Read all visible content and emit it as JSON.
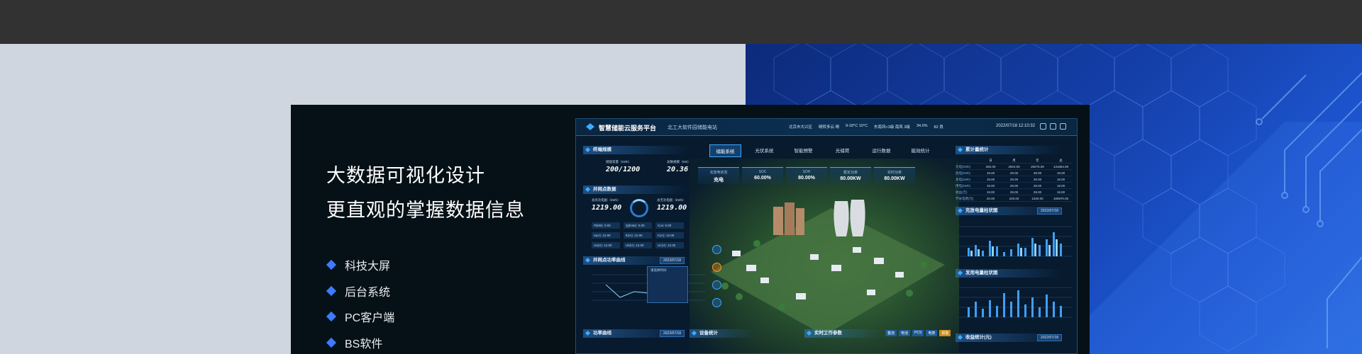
{
  "headline": {
    "line1": "大数据可视化设计",
    "line2": "更直观的掌握数据信息"
  },
  "features": [
    "科技大屏",
    "后台系统",
    "PC客户端",
    "BS软件"
  ],
  "colors": {
    "accent": "#3d7bff",
    "card_bg": "#061117",
    "blue_bg": "#143fa8"
  },
  "dashboard": {
    "title": "智慧储能云服务平台",
    "subtitle": "北工大软件园储能电站",
    "weather": [
      "北京市大兴区",
      "晴转多云 晴",
      "9-18°C 10°C",
      "东南风<3级 南风 3级",
      "34.0%",
      "82 良"
    ],
    "datetime": "2022/07/18  12:10:32",
    "nav_tabs": [
      "储能系统",
      "光伏系统",
      "智能预警",
      "光储荷",
      "运行数据",
      "能效统计"
    ],
    "active_tab": "储能系统",
    "kpis": [
      {
        "label": "充放电状态",
        "value": "充电"
      },
      {
        "label": "SOC",
        "value": "60.00%"
      },
      {
        "label": "SOH",
        "value": "80.00%"
      },
      {
        "label": "额定功率",
        "value": "80.00KW"
      },
      {
        "label": "实时功率",
        "value": "80.00KW"
      }
    ],
    "panels": {
      "terminal": {
        "title": "终端规模",
        "capacity_label": "储能容量（kWh）",
        "capacity_value": "200/1200",
        "count_label": "总数规模（kW）",
        "count_value": "20.36"
      },
      "grid": {
        "title": "并网点数据",
        "left_label": "总有功电能（kWh）",
        "left_value": "1219.00",
        "right_label": "总无功电能（kWh）",
        "right_value": "1219.00",
        "mini": [
          "P(kW): 0.00",
          "Q(kVar): 0.00",
          "Cos: 0.00",
          "Ia(A): 12.00",
          "Ib(A): 12.00",
          "Ic(A): 12.00",
          "Ua(V): 12.00",
          "Ub(V): 12.00",
          "Uc(V): 12.00"
        ]
      },
      "power_curve": {
        "title": "并网点功率曲线",
        "date": "2022/07/18",
        "picker_title": "请选择时间"
      },
      "power_curve2": {
        "title": "功率曲线",
        "date": "2022/07/18"
      },
      "device": {
        "title": "设备统计"
      },
      "realtime": {
        "title": "实时工作参数",
        "tabs": [
          "整流",
          "电池",
          "PCS",
          "电表",
          "报警"
        ]
      },
      "cumulative": {
        "title": "累计量统计",
        "headers": [
          "",
          "日",
          "月",
          "年",
          "总"
        ],
        "rows": [
          [
            "充电(kWh)",
            "292.00",
            "2924.00",
            "29275.00",
            "131854.00"
          ],
          [
            "放电(kWh)",
            "19.00",
            "29.00",
            "39.00",
            "19.00"
          ],
          [
            "发电(kWh)",
            "19.00",
            "29.00",
            "29.00",
            "19.00"
          ],
          [
            "用电(kWh)",
            "19.00",
            "29.00",
            "29.00",
            "19.00"
          ],
          [
            "收益(元)",
            "19.00",
            "29.00",
            "29.00",
            "19.00"
          ],
          [
            "节省电费(元)",
            "20.00",
            "220.00",
            "1020.00",
            "180970.00"
          ]
        ]
      },
      "charge_bar": {
        "title": "充放电量柱状图",
        "date": "2022/07/18"
      },
      "gen_bar": {
        "title": "发用电量柱状图"
      },
      "income": {
        "title": "收益统计(元)",
        "date": "2022/07/18"
      }
    }
  }
}
